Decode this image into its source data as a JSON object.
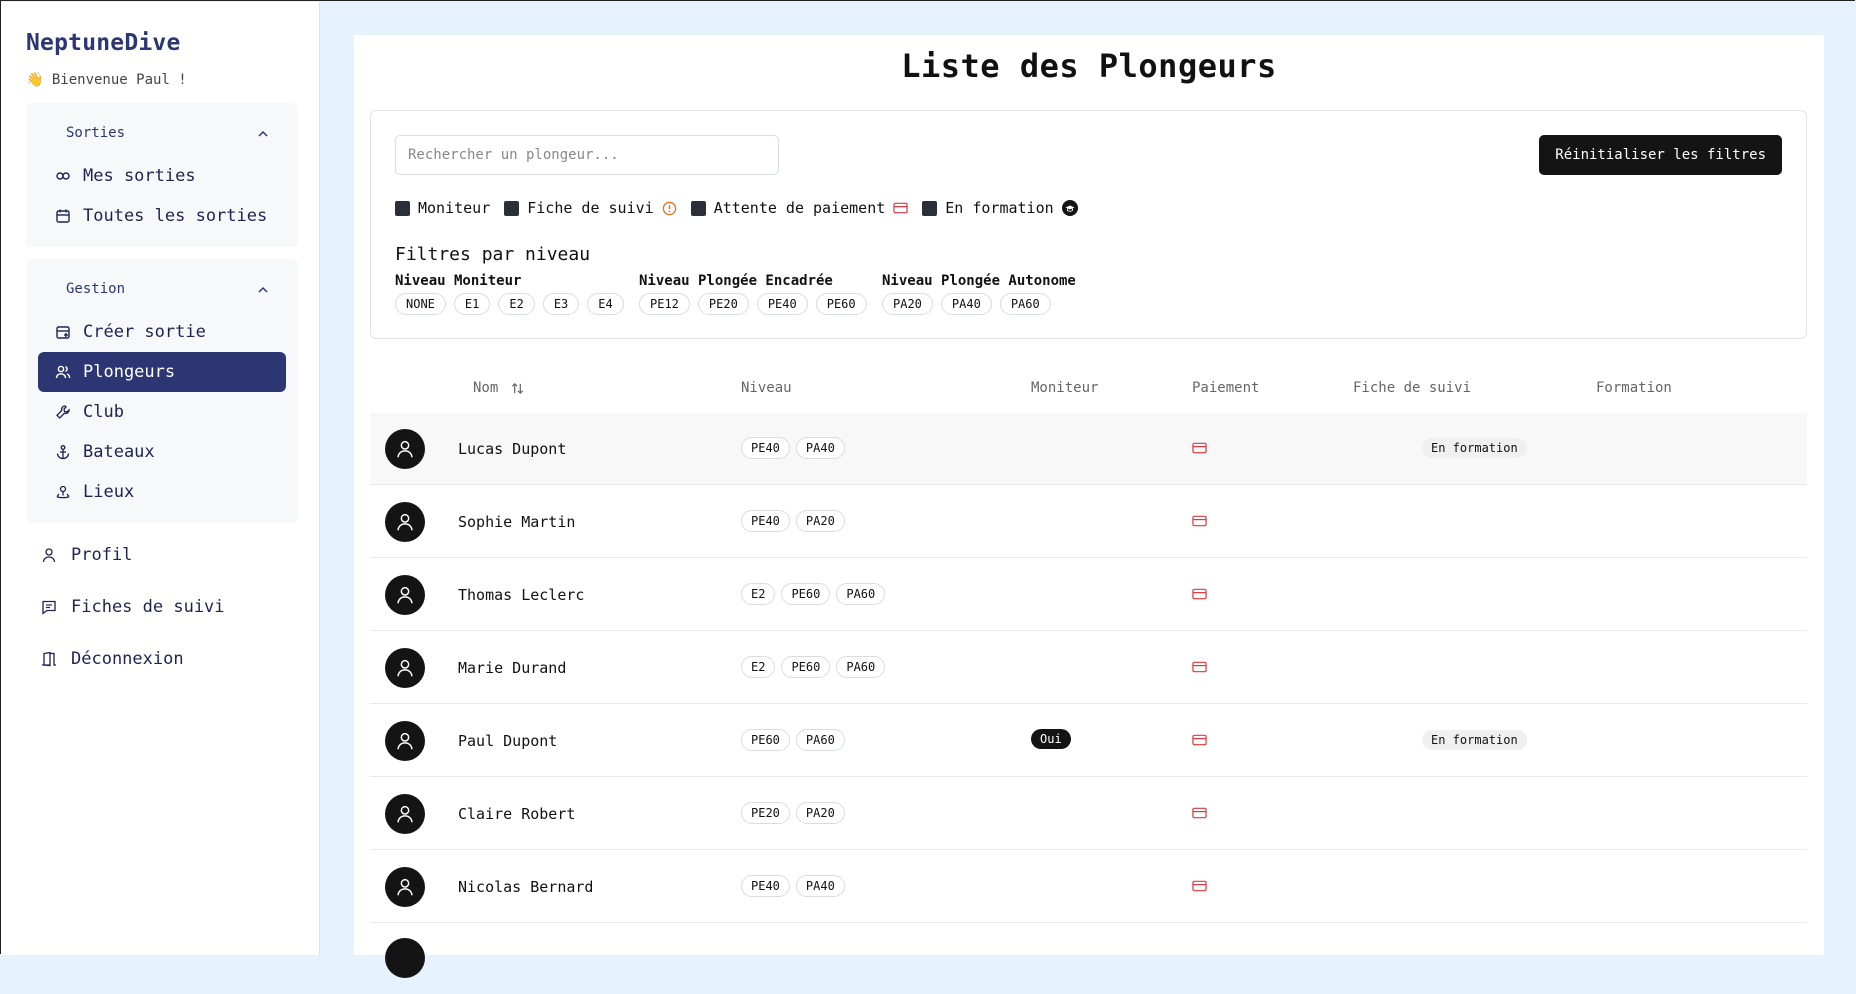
{
  "app": {
    "brand": "NeptuneDive",
    "welcome": "👋 Bienvenue Paul !"
  },
  "sidebar": {
    "groups": [
      {
        "title": "Sorties",
        "items": [
          {
            "label": "Mes sorties",
            "icon": "dive-icon"
          },
          {
            "label": "Toutes les sorties",
            "icon": "calendar-icon"
          }
        ]
      },
      {
        "title": "Gestion",
        "items": [
          {
            "label": "Créer sortie",
            "icon": "calendar-plus-icon"
          },
          {
            "label": "Plongeurs",
            "icon": "users-icon",
            "active": true
          },
          {
            "label": "Club",
            "icon": "wrench-icon"
          },
          {
            "label": "Bateaux",
            "icon": "anchor-icon"
          },
          {
            "label": "Lieux",
            "icon": "location-icon"
          }
        ]
      }
    ],
    "links": [
      {
        "label": "Profil",
        "icon": "user-icon"
      },
      {
        "label": "Fiches de suivi",
        "icon": "message-icon"
      },
      {
        "label": "Déconnexion",
        "icon": "door-icon"
      }
    ]
  },
  "page": {
    "title": "Liste des Plongeurs"
  },
  "filters": {
    "search_placeholder": "Rechercher un plongeur...",
    "reset_label": "Réinitialiser les filtres",
    "checkboxes": [
      {
        "label": "Moniteur"
      },
      {
        "label": "Fiche de suivi"
      },
      {
        "label": "Attente de paiement"
      },
      {
        "label": "En formation"
      }
    ],
    "level_title": "Filtres par niveau",
    "levels": [
      {
        "title": "Niveau Moniteur",
        "chips": [
          "NONE",
          "E1",
          "E2",
          "E3",
          "E4"
        ]
      },
      {
        "title": "Niveau Plongée Encadrée",
        "chips": [
          "PE12",
          "PE20",
          "PE40",
          "PE60"
        ]
      },
      {
        "title": "Niveau Plongée Autonome",
        "chips": [
          "PA20",
          "PA40",
          "PA60"
        ]
      }
    ]
  },
  "table": {
    "headers": {
      "nom": "Nom",
      "niveau": "Niveau",
      "moniteur": "Moniteur",
      "paiement": "Paiement",
      "fiche": "Fiche de suivi",
      "formation": "Formation"
    },
    "rows": [
      {
        "name": "Lucas Dupont",
        "levels": [
          "PE40",
          "PA40"
        ],
        "moniteur": "",
        "formation": "En formation"
      },
      {
        "name": "Sophie Martin",
        "levels": [
          "PE40",
          "PA20"
        ],
        "moniteur": "",
        "formation": ""
      },
      {
        "name": "Thomas Leclerc",
        "levels": [
          "E2",
          "PE60",
          "PA60"
        ],
        "moniteur": "",
        "formation": ""
      },
      {
        "name": "Marie Durand",
        "levels": [
          "E2",
          "PE60",
          "PA60"
        ],
        "moniteur": "",
        "formation": ""
      },
      {
        "name": "Paul Dupont",
        "levels": [
          "PE60",
          "PA60"
        ],
        "moniteur": "Oui",
        "formation": "En formation"
      },
      {
        "name": "Claire Robert",
        "levels": [
          "PE20",
          "PA20"
        ],
        "moniteur": "",
        "formation": ""
      },
      {
        "name": "Nicolas Bernard",
        "levels": [
          "PE40",
          "PA40"
        ],
        "moniteur": "",
        "formation": ""
      }
    ]
  },
  "colors": {
    "brand": "#2c3673",
    "active_bg": "#2c3673",
    "warning": "#e8701a",
    "payment": "#e0383e"
  }
}
